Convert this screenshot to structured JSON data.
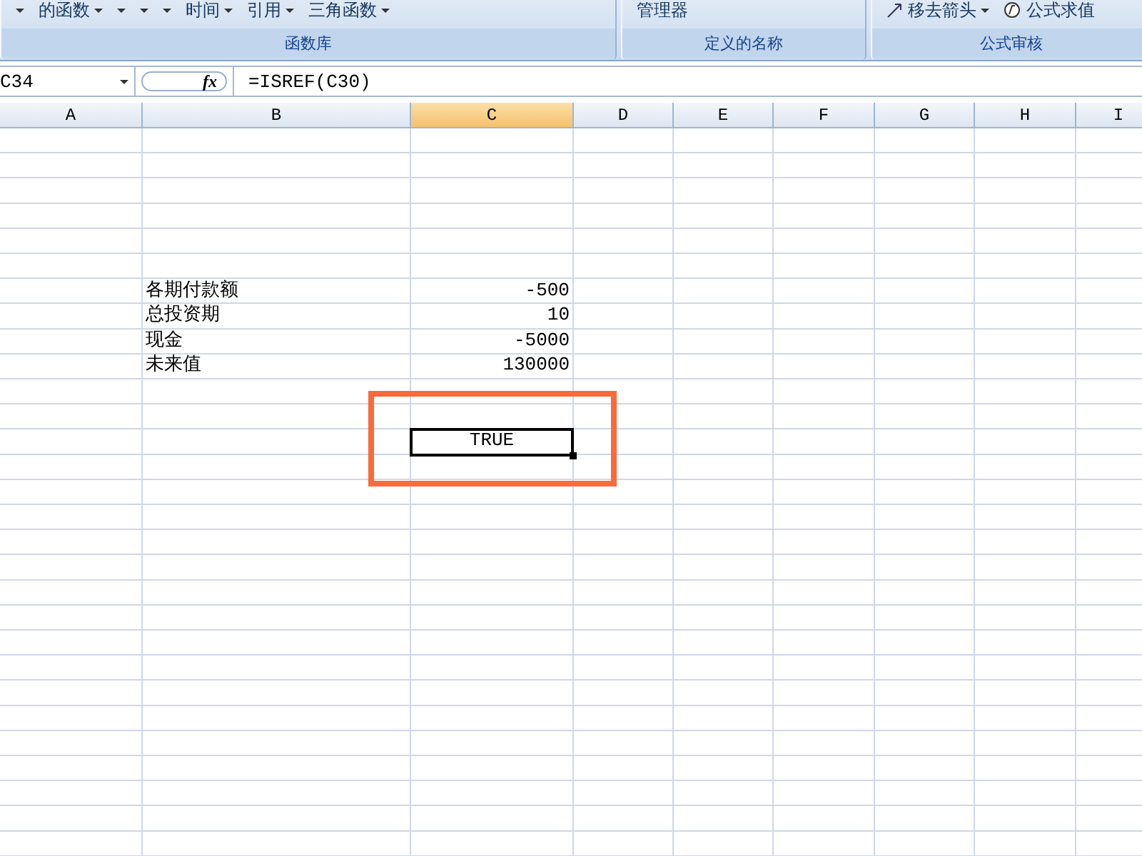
{
  "ribbon": {
    "groups": [
      {
        "label": "函数库",
        "items": [
          {
            "dropdown": true
          },
          {
            "label": "的函数",
            "dropdown": true
          },
          {
            "dropdown": true
          },
          {
            "dropdown": true
          },
          {
            "dropdown": true
          },
          {
            "label": "时间",
            "dropdown": true
          },
          {
            "label": "引用",
            "dropdown": true
          },
          {
            "label": "三角函数",
            "dropdown": true
          }
        ]
      },
      {
        "label": "定义的名称",
        "items": [
          {
            "label": "管理器",
            "dropdown": false
          }
        ]
      },
      {
        "label": "公式审核",
        "items": [
          {
            "label": "移去箭头",
            "dropdown": true,
            "kind": "trace"
          },
          {
            "label": "公式求值",
            "dropdown": false,
            "kind": "evaluate"
          }
        ]
      }
    ]
  },
  "formula_bar": {
    "name_box": "C34",
    "fx": "fx",
    "formula": "=ISREF(C30)"
  },
  "columns": [
    {
      "label": "A",
      "selected": false
    },
    {
      "label": "B",
      "selected": false
    },
    {
      "label": "C",
      "selected": true
    },
    {
      "label": "D",
      "selected": false
    },
    {
      "label": "E",
      "selected": false
    },
    {
      "label": "F",
      "selected": false
    },
    {
      "label": "G",
      "selected": false
    },
    {
      "label": "H",
      "selected": false
    },
    {
      "label": "I",
      "selected": false
    }
  ],
  "rows": [
    {},
    {},
    {},
    {},
    {},
    {},
    {
      "label": "各期付款额",
      "value": "-500",
      "selected": false
    },
    {
      "label": "总投资期",
      "value": "10",
      "selected": false
    },
    {
      "label": "现金",
      "value": "-5000",
      "selected": false
    },
    {
      "label": "未来值",
      "value": "130000",
      "selected": false
    },
    {},
    {},
    {
      "value": "TRUE",
      "selected": true
    },
    {},
    {},
    {},
    {},
    {},
    {},
    {},
    {},
    {},
    {},
    {},
    {},
    {},
    {},
    {},
    {}
  ],
  "annotation": {
    "highlight": true
  }
}
